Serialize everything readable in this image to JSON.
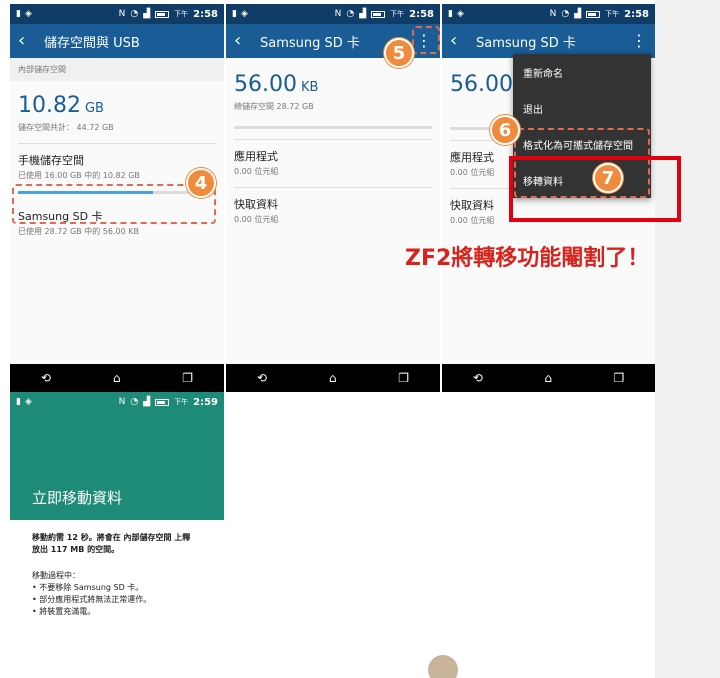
{
  "status": {
    "time1": "2:58",
    "time2": "2:58",
    "time3": "2:58",
    "time4": "2:59",
    "ampm": "下午"
  },
  "screen1": {
    "title": "儲存空間與 USB",
    "section": "內部儲存空間",
    "big_value": "10.82",
    "big_unit": "GB",
    "total_line": "儲存空間共計： 44.72 GB",
    "phone_title": "手機儲存空間",
    "phone_sub": "已使用 16.00 GB 中的 10.82 GB",
    "phone_progress": 0.68,
    "sd_title": "Samsung SD 卡",
    "sd_sub": "已使用 28.72 GB 中的 56.00 KB"
  },
  "screen2": {
    "title": "Samsung SD 卡",
    "big_value": "56.00",
    "big_unit": "KB",
    "total_line": "總儲存空間 28.72 GB",
    "apps_title": "應用程式",
    "apps_sub": "0.00 位元組",
    "cache_title": "快取資料",
    "cache_sub": "0.00 位元組"
  },
  "screen3": {
    "title": "Samsung SD 卡",
    "big_value": "56.00",
    "apps_title": "應用程式",
    "apps_sub": "0.00 位元組",
    "cache_title": "快取資料",
    "cache_sub": "0.00 位元組",
    "menu": [
      "重新命名",
      "退出",
      "格式化為可攜式儲存空間",
      "移轉資料"
    ]
  },
  "screen4": {
    "title": "立即移動資料",
    "line1": "移動約需 12 秒。將會在 內部儲存空間 上釋",
    "line2": "放出 117 MB 的空間。",
    "list_header": "移動過程中：",
    "bullets": [
      "• 不要移除 Samsung SD 卡。",
      "• 部分應用程式將無法正常運作。",
      "• 將裝置充滿電。"
    ]
  },
  "badges": {
    "b4": "4",
    "b5": "5",
    "b6": "6",
    "b7": "7"
  },
  "annotation": "ZF2將轉移功能閹割了！",
  "colors": {
    "statusbar": "#0f3d67",
    "appbar": "#1a5c96",
    "accent": "#4aa3df",
    "badge": "#f08a3c",
    "green": "#1d8b78",
    "red": "#e3000f"
  }
}
